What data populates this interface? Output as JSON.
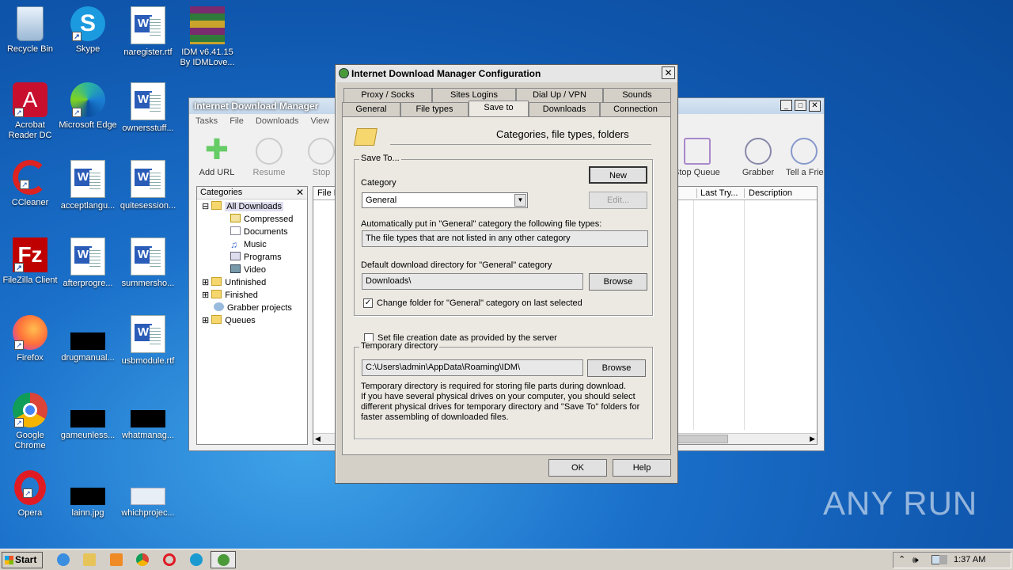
{
  "desktop": {
    "icons": [
      {
        "label": "Recycle Bin"
      },
      {
        "label": "Skype"
      },
      {
        "label": "naregister.rtf"
      },
      {
        "label": "IDM v6.41.15 By IDMLove..."
      },
      {
        "label": "Acrobat Reader DC"
      },
      {
        "label": "Microsoft Edge"
      },
      {
        "label": "ownersstuff..."
      },
      {
        "label": "CCleaner"
      },
      {
        "label": "acceptlangu..."
      },
      {
        "label": "quitesession..."
      },
      {
        "label": "FileZilla Client"
      },
      {
        "label": "afterprogre..."
      },
      {
        "label": "summersho..."
      },
      {
        "label": "Firefox"
      },
      {
        "label": "drugmanual..."
      },
      {
        "label": "usbmodule.rtf"
      },
      {
        "label": "Google Chrome"
      },
      {
        "label": "gameunless..."
      },
      {
        "label": "whatmanag..."
      },
      {
        "label": "Opera"
      },
      {
        "label": "lainn.jpg"
      },
      {
        "label": "whichprojec..."
      }
    ]
  },
  "idm_main": {
    "title": "Internet Download Manager",
    "menu": [
      "Tasks",
      "File",
      "Downloads",
      "View",
      "He"
    ],
    "toolbar": {
      "add_url": "Add URL",
      "resume": "Resume",
      "stop": "Stop",
      "stop_queue": "Stop Queue",
      "grabber": "Grabber",
      "tell": "Tell a Frie"
    },
    "categories_header": "Categories",
    "tree": [
      "All Downloads",
      "Compressed",
      "Documents",
      "Music",
      "Programs",
      "Video",
      "Unfinished",
      "Finished",
      "Grabber projects",
      "Queues"
    ],
    "columns": {
      "file": "File N",
      "last_try": "Last Try...",
      "description": "Description"
    }
  },
  "dialog": {
    "title": "Internet Download Manager Configuration",
    "tabs_row1": [
      "Proxy / Socks",
      "Sites Logins",
      "Dial Up / VPN",
      "Sounds"
    ],
    "tabs_row2": [
      "General",
      "File types",
      "Save to",
      "Downloads",
      "Connection"
    ],
    "heading": "Categories, file types, folders",
    "save_to_legend": "Save To...",
    "category_label": "Category",
    "category_value": "General",
    "new_button": "New",
    "edit_button": "Edit...",
    "auto_label": "Automatically put in \"General\" category the following file types:",
    "auto_value": "The file types that are not listed in any other category",
    "default_dir_label": "Default download directory for \"General\" category",
    "default_dir_value": "Downloads\\",
    "browse1": "Browse",
    "change_folder_label": "Change folder for \"General\" category on last selected",
    "set_date_label": "Set file creation date as provided by the server",
    "temp_legend": "Temporary directory",
    "temp_value": "C:\\Users\\admin\\AppData\\Roaming\\IDM\\",
    "browse2": "Browse",
    "temp_note1": "Temporary directory is required for storing file parts during download.",
    "temp_note2": "If you have several physical drives on your computer, you should select",
    "temp_note3": "different physical drives for temporary directory and \"Save To\" folders for",
    "temp_note4": "faster assembling of downloaded files.",
    "ok": "OK",
    "help": "Help"
  },
  "taskbar": {
    "start": "Start",
    "time": "1:37 AM"
  },
  "watermark": "ANY RUN"
}
